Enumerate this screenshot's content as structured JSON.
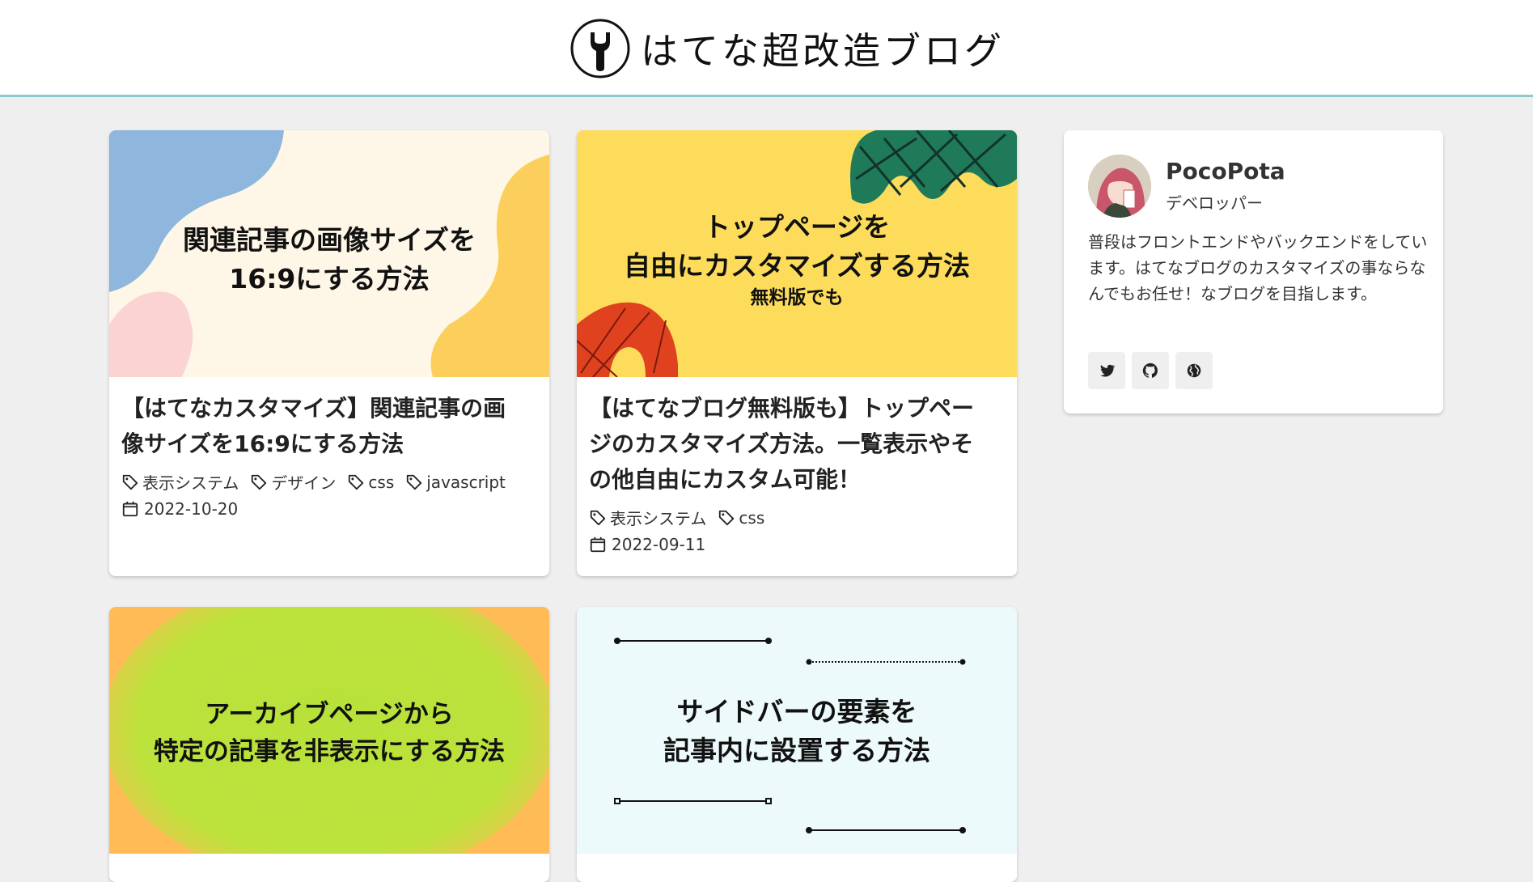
{
  "site": {
    "title": "はてな超改造ブログ",
    "accent_color": "#8ec9d0"
  },
  "posts": [
    {
      "thumb_line1": "関連記事の画像サイズを",
      "thumb_line2": "16:9にする方法",
      "thumb_line3": "",
      "title_line1": "【はてなカスタマイズ】関連記事の画",
      "title_line2": "像サイズを16:9にする方法",
      "title_line3": "",
      "tags": [
        "表示システム",
        "デザイン",
        "css",
        "javascript"
      ],
      "date": "2022-10-20"
    },
    {
      "thumb_line1": "トップページを",
      "thumb_line2": "自由にカスタマイズする方法",
      "thumb_line3": "無料版でも",
      "title_line1": "【はてなブログ無料版も】トップペー",
      "title_line2": "ジのカスタマイズ方法。一覧表示やそ",
      "title_line3": "の他自由にカスタム可能！",
      "tags": [
        "表示システム",
        "css"
      ],
      "date": "2022-09-11"
    },
    {
      "thumb_line1": "アーカイブページから",
      "thumb_line2": "特定の記事を非表示にする方法",
      "thumb_line3": ""
    },
    {
      "thumb_line1": "サイドバーの要素を",
      "thumb_line2": "記事内に設置する方法",
      "thumb_line3": ""
    }
  ],
  "profile": {
    "name": "PocoPota",
    "role": "デベロッパー",
    "bio": "普段はフロントエンドやバックエンドをしています。はてなブログのカスタマイズの事ならなんでもお任せ！なブログを目指します。",
    "links": [
      "twitter-icon",
      "github-icon",
      "globe-icon"
    ]
  }
}
